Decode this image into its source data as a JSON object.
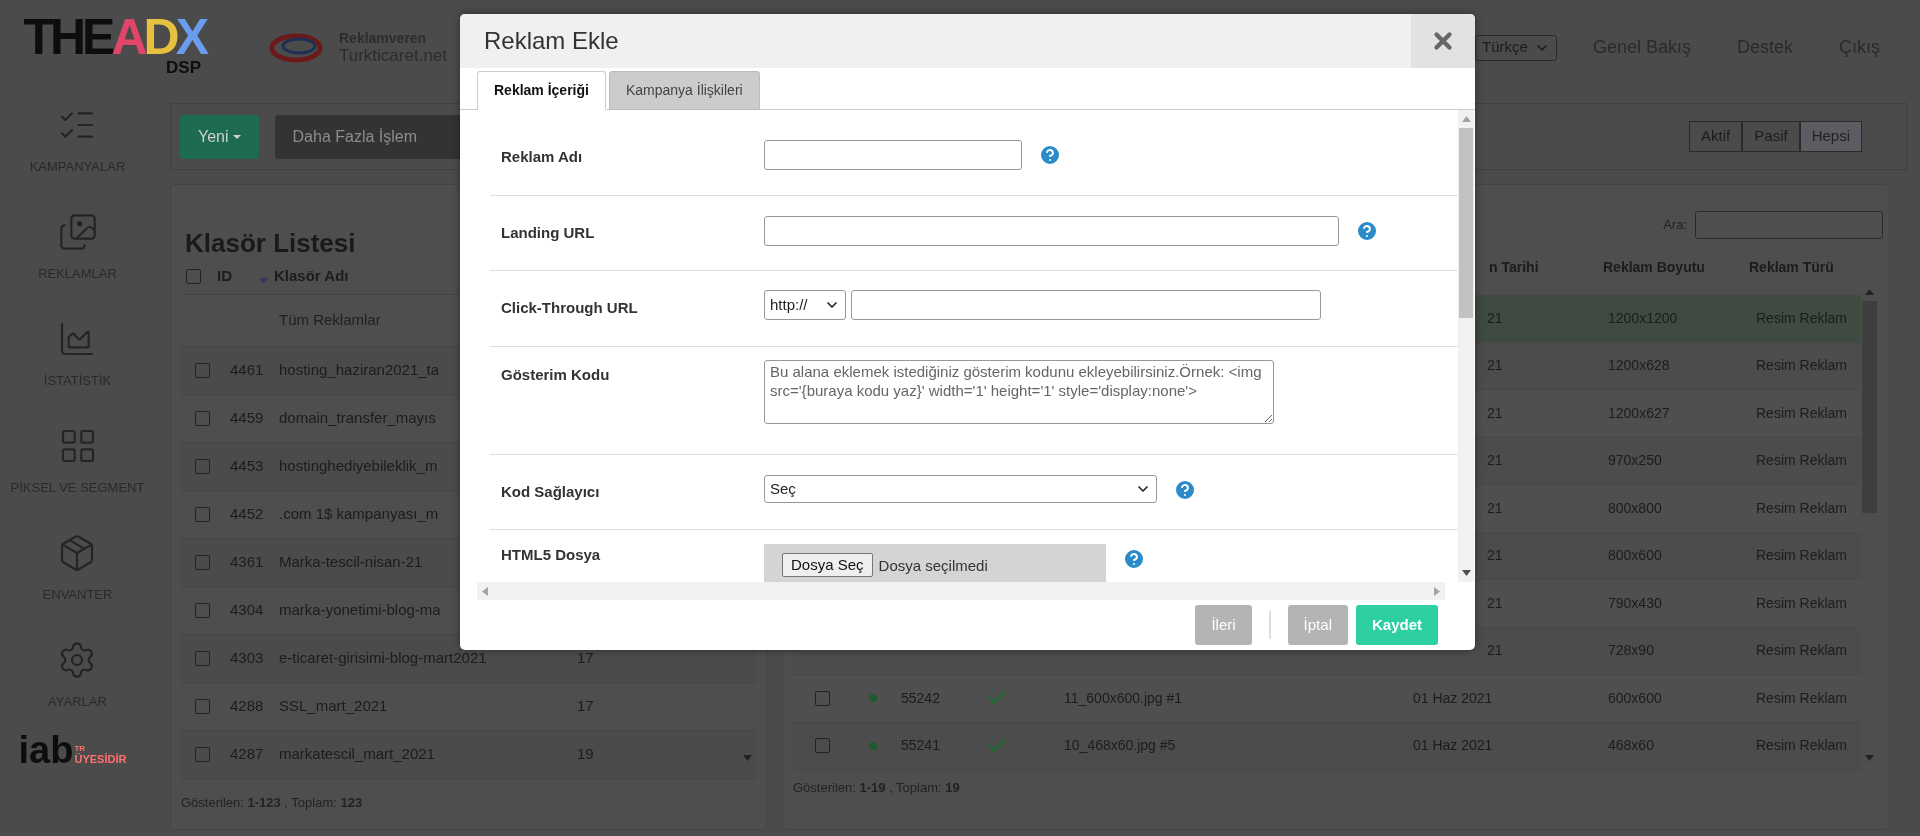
{
  "logo": {
    "parts": [
      {
        "text": "THE",
        "color": "#0d0d0d"
      },
      {
        "text": "A",
        "color": "#e0456a"
      },
      {
        "text": "D",
        "color": "#e8c040"
      },
      {
        "text": "X",
        "color": "#6a9cf0"
      }
    ],
    "sub": "DSP"
  },
  "header": {
    "advertiser_label": "Reklamveren",
    "advertiser_name": "Turkticaret.net",
    "language": "Türkçe",
    "nav": [
      "Genel Bakış",
      "Destek",
      "Çıkış"
    ]
  },
  "sidebar": [
    {
      "kind": "campaigns",
      "label": "KAMPANYALAR"
    },
    {
      "kind": "ads",
      "label": "REKLAMLAR"
    },
    {
      "kind": "stats",
      "label": "İSTATİSTİK"
    },
    {
      "kind": "pixel",
      "label": "PİKSEL VE SEGMENT"
    },
    {
      "kind": "inventory",
      "label": "ENVANTER"
    },
    {
      "kind": "settings",
      "label": "AYARLAR"
    }
  ],
  "iab": {
    "text": "iab",
    "tag": "TR",
    "sub": "ÜYESİDİR"
  },
  "toolbar": {
    "new_button": "Yeni",
    "more_button": "Daha Fazla İşlem",
    "filters": [
      {
        "label": "Aktif",
        "selected": false
      },
      {
        "label": "Pasif",
        "selected": false
      },
      {
        "label": "Hepsi",
        "selected": true
      }
    ]
  },
  "folders": {
    "title": "Klasör Listesi",
    "select_all_checked": false,
    "columns": [
      "ID",
      "Klasör Adı"
    ],
    "all_row": "Tüm Reklamlar",
    "rows": [
      {
        "id": "4461",
        "name": "hosting_haziran2021_ta",
        "checked": false
      },
      {
        "id": "4459",
        "name": "domain_transfer_mayıs",
        "checked": false
      },
      {
        "id": "4453",
        "name": "hostinghediyebileklik_m",
        "checked": false
      },
      {
        "id": "4452",
        "name": ".com 1$ kampanyası_m",
        "checked": false
      },
      {
        "id": "4361",
        "name": "Marka-tescil-nisan-21",
        "checked": false
      },
      {
        "id": "4304",
        "name": "marka-yonetimi-blog-ma",
        "checked": false
      },
      {
        "id": "4303",
        "name": "e-ticaret-girisimi-blog-mart2021",
        "count": "17",
        "checked": false
      },
      {
        "id": "4288",
        "name": "SSL_mart_2021",
        "count": "17",
        "checked": false
      },
      {
        "id": "4287",
        "name": "markatescil_mart_2021",
        "count": "19",
        "checked": false
      }
    ],
    "footer": "Gösterilen: **1-123** , Toplam: **123**"
  },
  "ads": {
    "search_label": "Ara:",
    "columns": [
      "n Tarihi",
      "Reklam Boyutu",
      "Reklam Türü"
    ],
    "rows": [
      {
        "date": "21",
        "size": "1200x1200",
        "type": "Resim Reklam",
        "selected": true
      },
      {
        "date": "21",
        "size": "1200x628",
        "type": "Resim Reklam",
        "selected": false
      },
      {
        "date": "21",
        "size": "1200x627",
        "type": "Resim Reklam",
        "selected": false
      },
      {
        "date": "21",
        "size": "970x250",
        "type": "Resim Reklam",
        "selected": false
      },
      {
        "date": "21",
        "size": "800x800",
        "type": "Resim Reklam",
        "selected": false
      },
      {
        "date": "21",
        "size": "800x600",
        "type": "Resim Reklam",
        "selected": false
      },
      {
        "date": "21",
        "size": "790x430",
        "type": "Resim Reklam",
        "selected": false
      },
      {
        "date": "21",
        "size": "728x90",
        "type": "Resim Reklam",
        "selected": false
      },
      {
        "id": "55242",
        "name": "11_600x600.jpg #1",
        "date": "01 Haz 2021",
        "size": "600x600",
        "type": "Resim Reklam",
        "selected": false,
        "checked": false,
        "color": "#1c5c30",
        "approved": true
      },
      {
        "id": "55241",
        "name": "10_468x60.jpg #5",
        "date": "01 Haz 2021",
        "size": "468x60",
        "type": "Resim Reklam",
        "selected": false,
        "checked": false,
        "color": "#1c5c30",
        "approved": true
      }
    ],
    "footer": "Gösterilen: **1-19** , Toplam: **19**"
  },
  "modal": {
    "title": "Reklam Ekle",
    "tabs": [
      {
        "label": "Reklam İçeriği",
        "selected": true
      },
      {
        "label": "Kampanya İlişkileri",
        "selected": false
      }
    ],
    "fields": [
      {
        "kind": "short_text",
        "label": "Reklam Adı",
        "help": true
      },
      {
        "kind": "long_text",
        "label": "Landing URL",
        "help": true
      },
      {
        "kind": "protocol_url",
        "label": "Click-Through URL",
        "protocol": "http://",
        "help": false
      },
      {
        "kind": "textarea",
        "label": "Gösterim Kodu",
        "placeholder": "Bu alana eklemek istediğiniz gösterim kodunu ekleyebilirsiniz.Örnek: <img src='{buraya kodu yaz}' width='1' height='1' style='display:none'>",
        "help": false
      },
      {
        "kind": "select",
        "label": "Kod Sağlayıcı",
        "value": "Seç",
        "help": true
      },
      {
        "kind": "file",
        "label": "HTML5 Dosya",
        "button": "Dosya Seç",
        "status": "Dosya seçilmedi",
        "help": true
      }
    ],
    "buttons": [
      {
        "label": "İleri",
        "kind": "secondary"
      },
      {
        "label": "İptal",
        "kind": "secondary"
      },
      {
        "label": "Kaydet",
        "kind": "primary"
      }
    ]
  }
}
